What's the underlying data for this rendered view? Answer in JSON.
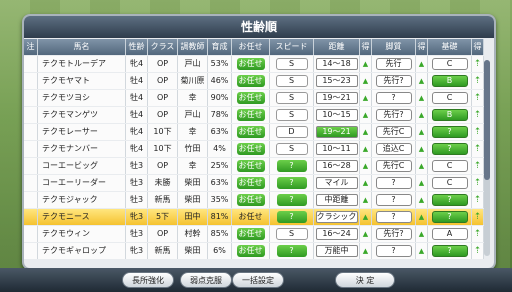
{
  "title": "性齢順",
  "headers": [
    "注",
    "馬名",
    "性齢",
    "クラス",
    "調教師",
    "育成",
    "お任せ",
    "スピード",
    "距離",
    "得",
    "脚質",
    "得",
    "基礎",
    "得"
  ],
  "rows": [
    {
      "name": "テクモトルーデア",
      "sex": "牝4",
      "cls": "OP",
      "trainer": "戸山",
      "grow": "53%",
      "omakase": "お任せ",
      "speed": "S",
      "dist": "14〜18",
      "style": "先行",
      "base": "C"
    },
    {
      "name": "テクモヤマト",
      "sex": "牡4",
      "cls": "OP",
      "trainer": "菊川原",
      "grow": "46%",
      "omakase": "お任せ",
      "speed": "S",
      "dist": "15〜23",
      "style": "先行?",
      "base": "B"
    },
    {
      "name": "テクモツヨシ",
      "sex": "牡4",
      "cls": "OP",
      "trainer": "幸",
      "grow": "90%",
      "omakase": "お任せ",
      "speed": "S",
      "dist": "19〜21",
      "style": "?",
      "base": "C"
    },
    {
      "name": "テクモマンゲツ",
      "sex": "牡4",
      "cls": "OP",
      "trainer": "戸山",
      "grow": "78%",
      "omakase": "お任せ",
      "speed": "S",
      "dist": "10〜15",
      "style": "先行?",
      "base": "B"
    },
    {
      "name": "テクモレーサー",
      "sex": "牝4",
      "cls": "10下",
      "trainer": "幸",
      "grow": "63%",
      "omakase": "お任せ",
      "speed": "D",
      "dist": "19〜21",
      "style": "先行C",
      "base": "?"
    },
    {
      "name": "テクモナンバー",
      "sex": "牝4",
      "cls": "10下",
      "trainer": "竹田",
      "grow": "4%",
      "omakase": "お任せ",
      "speed": "S",
      "dist": "10〜11",
      "style": "追込C",
      "base": "?"
    },
    {
      "name": "コーエービッグ",
      "sex": "牡3",
      "cls": "OP",
      "trainer": "幸",
      "grow": "25%",
      "omakase": "お任せ",
      "speed": "?",
      "dist": "16〜28",
      "style": "先行C",
      "base": "C"
    },
    {
      "name": "コーエーリーダー",
      "sex": "牡3",
      "cls": "未勝",
      "trainer": "柴田",
      "grow": "63%",
      "omakase": "お任せ",
      "speed": "?",
      "dist": "マイル",
      "style": "?",
      "base": "C"
    },
    {
      "name": "テクモジャック",
      "sex": "牡3",
      "cls": "新馬",
      "trainer": "柴田",
      "grow": "35%",
      "omakase": "お任せ",
      "speed": "?",
      "dist": "中距離",
      "style": "?",
      "base": "?"
    },
    {
      "name": "テクモニース",
      "sex": "牝3",
      "cls": "5下",
      "trainer": "田中",
      "grow": "81%",
      "omakase": "お任せ",
      "speed": "?",
      "dist": "クラシック",
      "style": "?",
      "base": "?"
    },
    {
      "name": "テクモウィン",
      "sex": "牡3",
      "cls": "OP",
      "trainer": "村幹",
      "grow": "85%",
      "omakase": "お任せ",
      "speed": "S",
      "dist": "16〜24",
      "style": "先行?",
      "base": "A"
    },
    {
      "name": "テクモギャロップ",
      "sex": "牝3",
      "cls": "新馬",
      "trainer": "柴田",
      "grow": "6%",
      "omakase": "お任せ",
      "speed": "?",
      "dist": "万能中",
      "style": "?",
      "base": "?"
    }
  ],
  "buttons": {
    "b1": "長所強化",
    "b2": "弱点克服",
    "b3": "一括設定",
    "b4": "決 定"
  },
  "colors": {
    "accent": "#f5c230",
    "green": "#2f9a22"
  }
}
